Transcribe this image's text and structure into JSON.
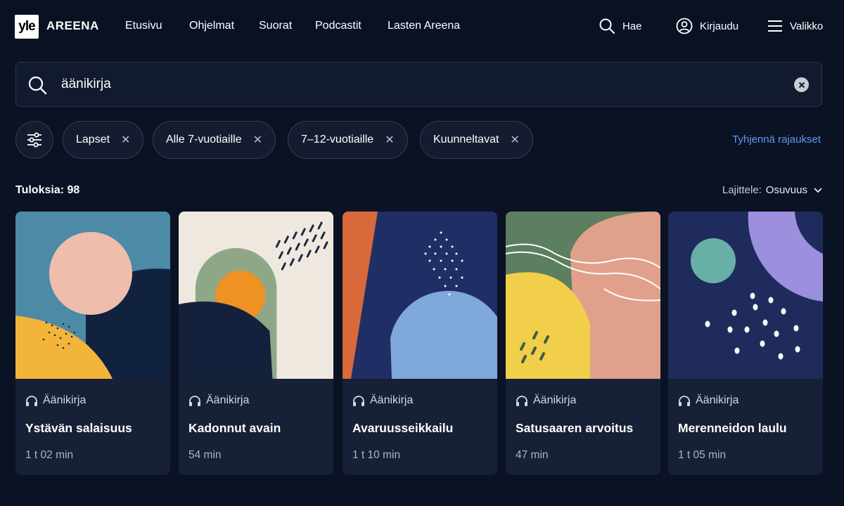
{
  "header": {
    "logo_mark": "yle",
    "logo_text": "AREENA",
    "nav": [
      "Etusivu",
      "Ohjelmat",
      "Suorat",
      "Podcastit",
      "Lasten Areena"
    ],
    "search_label": "Hae",
    "login_label": "Kirjaudu",
    "menu_label": "Valikko"
  },
  "search": {
    "value": "äänikirja",
    "placeholder": "Hae"
  },
  "filters": {
    "chips": [
      "Lapset",
      "Alle 7-vuotiaille",
      "7–12-vuotiaille",
      "Kuunneltavat"
    ],
    "clear_label": "Tyhjennä rajaukset"
  },
  "results": {
    "count_label": "Tuloksia: 98",
    "sort_label": "Lajittele:",
    "sort_value": "Osuvuus"
  },
  "cards": [
    {
      "type": "Äänikirja",
      "title": "Ystävän salaisuus",
      "duration": "1 t 02 min"
    },
    {
      "type": "Äänikirja",
      "title": "Kadonnut avain",
      "duration": "54 min"
    },
    {
      "type": "Äänikirja",
      "title": "Avaruusseikkailu",
      "duration": "1 t 10 min"
    },
    {
      "type": "Äänikirja",
      "title": "Satusaaren arvoitus",
      "duration": "47 min"
    },
    {
      "type": "Äänikirja",
      "title": "Merenneidon laulu",
      "duration": "1 t 05 min"
    }
  ],
  "colors": {
    "background": "#0b1224",
    "card": "#162036",
    "accent_link": "#5b9cf2"
  }
}
